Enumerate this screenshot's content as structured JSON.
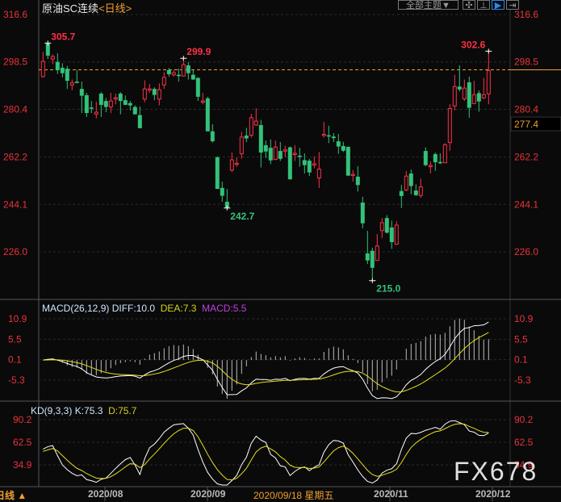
{
  "header": {
    "symbol": "原油SC连续",
    "period": "<日线>",
    "theme_button": "全部主题▼",
    "tool_icons": [
      "crosshair-icon",
      "range-icon",
      "play-icon",
      "exit-icon"
    ]
  },
  "colors": {
    "up": "#ff3048",
    "down": "#33c27a",
    "axis": "#e8323c",
    "accent": "#f0a030",
    "diff": "#ffffff",
    "dea": "#e8e020",
    "macd": "#c040e0"
  },
  "price_axis": {
    "ticks": [
      "316.6",
      "298.5",
      "280.4",
      "262.2",
      "244.1",
      "226.0"
    ],
    "current_marker": "277.4",
    "reference_line": 298.5
  },
  "annotations": {
    "high1": "305.7",
    "high2": "299.9",
    "high3": "302.6",
    "low1": "242.7",
    "low2": "215.0"
  },
  "macd": {
    "title": "MACD(26,12,9)",
    "diff": "DIFF:10.0",
    "dea": "DEA:7.3",
    "macd": "MACD:5.5",
    "ticks": [
      "10.9",
      "5.5",
      "0.1",
      "-5.3"
    ]
  },
  "kd": {
    "title": "KD(9,3,3)",
    "k": "K:75.3",
    "d": "D:75.7",
    "ticks": [
      "90.2",
      "62.5",
      "34.9"
    ]
  },
  "date_axis": {
    "labels": [
      "2020/08",
      "2020/09",
      "2020/11",
      "2020/12"
    ],
    "crosshair_date": "2020/09/18 星期五",
    "period_toggle": "日线 ▲"
  },
  "watermark": "FX678",
  "chart_data": {
    "type": "candlestick",
    "ohlc": [
      [
        292.9,
        302.4,
        292.6,
        298.7
      ],
      [
        305.5,
        305.7,
        299.6,
        300.9
      ],
      [
        299.6,
        301.4,
        297.7,
        300.6
      ],
      [
        298.5,
        301.8,
        293.9,
        295.4
      ],
      [
        296.3,
        298.0,
        292.6,
        294.2
      ],
      [
        295.9,
        297.0,
        288.2,
        291.3
      ],
      [
        289.7,
        291.8,
        287.7,
        290.5
      ],
      [
        291.0,
        295.4,
        290.3,
        290.5
      ],
      [
        288.2,
        291.0,
        279.0,
        285.6
      ],
      [
        285.8,
        286.7,
        277.5,
        279.0
      ],
      [
        281.1,
        283.6,
        279.0,
        280.6
      ],
      [
        278.6,
        283.3,
        276.9,
        279.3
      ],
      [
        286.4,
        287.0,
        277.5,
        282.1
      ],
      [
        283.6,
        284.7,
        279.3,
        281.3
      ],
      [
        281.3,
        286.7,
        279.0,
        283.6
      ],
      [
        284.5,
        286.4,
        282.3,
        284.8
      ],
      [
        286.4,
        287.0,
        278.5,
        283.6
      ],
      [
        283.9,
        285.7,
        282.1,
        282.1
      ],
      [
        282.8,
        283.6,
        280.0,
        281.9
      ],
      [
        281.3,
        281.9,
        278.5,
        278.5
      ],
      [
        278.2,
        281.5,
        273.2,
        273.2
      ],
      [
        284.3,
        291.5,
        283.1,
        288.2
      ],
      [
        287.8,
        290.1,
        286.7,
        288.2
      ],
      [
        288.2,
        288.8,
        283.9,
        285.9
      ],
      [
        284.3,
        290.3,
        281.9,
        287.9
      ],
      [
        289.7,
        294.6,
        288.2,
        292.6
      ],
      [
        295.4,
        296.2,
        292.9,
        293.8
      ],
      [
        293.6,
        295.4,
        292.9,
        294.4
      ],
      [
        293.6,
        296.0,
        291.0,
        293.1
      ],
      [
        293.1,
        299.9,
        292.9,
        297.5
      ],
      [
        297.2,
        298.5,
        291.8,
        294.2
      ],
      [
        293.6,
        295.4,
        291.6,
        291.8
      ],
      [
        292.4,
        292.6,
        283.6,
        285.2
      ],
      [
        283.3,
        286.7,
        282.3,
        283.6
      ],
      [
        284.6,
        285.2,
        272.0,
        272.0
      ],
      [
        272.0,
        274.7,
        267.7,
        268.2
      ],
      [
        262.1,
        262.4,
        250.0,
        250.0
      ],
      [
        250.4,
        252.8,
        245.1,
        247.4
      ],
      [
        245.1,
        250.0,
        242.7,
        242.9
      ],
      [
        257.2,
        263.9,
        256.4,
        261.1
      ],
      [
        259.6,
        262.1,
        258.5,
        259.8
      ],
      [
        263.4,
        271.8,
        261.6,
        269.8
      ],
      [
        270.4,
        273.3,
        267.9,
        269.3
      ],
      [
        270.5,
        278.7,
        269.6,
        277.2
      ],
      [
        274.4,
        280.8,
        274.1,
        275.9
      ],
      [
        274.4,
        276.4,
        258.2,
        263.9
      ],
      [
        266.7,
        268.5,
        261.8,
        264.3
      ],
      [
        265.7,
        268.9,
        259.5,
        260.9
      ],
      [
        261.3,
        268.5,
        261.0,
        266.0
      ],
      [
        264.5,
        267.9,
        260.7,
        261.5
      ],
      [
        264.7,
        266.5,
        262.1,
        264.9
      ],
      [
        265.9,
        266.2,
        253.5,
        253.7
      ],
      [
        263.4,
        266.7,
        260.7,
        263.6
      ],
      [
        262.7,
        265.7,
        258.5,
        262.2
      ],
      [
        261.0,
        263.6,
        255.9,
        259.1
      ],
      [
        260.8,
        261.5,
        254.9,
        256.3
      ],
      [
        259.1,
        262.4,
        257.9,
        259.6
      ],
      [
        254.2,
        264.1,
        250.4,
        257.6
      ],
      [
        270.7,
        275.6,
        269.6,
        270.9
      ],
      [
        270.5,
        274.1,
        267.5,
        270.0
      ],
      [
        270.0,
        271.3,
        267.9,
        269.4
      ],
      [
        268.2,
        271.0,
        263.4,
        266.2
      ],
      [
        266.4,
        268.0,
        264.1,
        264.6
      ],
      [
        266.1,
        266.1,
        254.9,
        255.1
      ],
      [
        255.4,
        257.2,
        252.8,
        255.6
      ],
      [
        254.7,
        258.7,
        249.0,
        251.5
      ],
      [
        244.8,
        247.0,
        235.0,
        236.9
      ],
      [
        225.4,
        234.0,
        221.3,
        222.7
      ],
      [
        226.4,
        227.6,
        215.0,
        219.9
      ],
      [
        222.7,
        232.8,
        222.7,
        228.2
      ],
      [
        234.1,
        238.9,
        231.2,
        237.1
      ],
      [
        238.9,
        240.0,
        233.0,
        233.3
      ],
      [
        235.3,
        237.9,
        227.1,
        229.7
      ],
      [
        228.9,
        237.7,
        228.7,
        236.2
      ],
      [
        249.2,
        251.5,
        242.7,
        247.3
      ],
      [
        249.6,
        256.8,
        249.2,
        254.9
      ],
      [
        255.9,
        257.4,
        247.9,
        251.1
      ],
      [
        249.4,
        251.8,
        247.4,
        247.6
      ],
      [
        247.5,
        254.0,
        246.6,
        250.8
      ],
      [
        264.5,
        265.9,
        258.7,
        259.1
      ],
      [
        258.5,
        260.5,
        255.9,
        259.0
      ],
      [
        263.3,
        263.9,
        256.9,
        260.2
      ],
      [
        260.3,
        263.6,
        259.5,
        259.8
      ],
      [
        260.0,
        267.5,
        260.0,
        266.9
      ],
      [
        267.7,
        282.3,
        264.6,
        280.7
      ],
      [
        281.7,
        293.6,
        280.0,
        289.1
      ],
      [
        289.1,
        297.2,
        287.2,
        288.0
      ],
      [
        284.4,
        291.8,
        283.6,
        288.5
      ],
      [
        290.7,
        292.9,
        277.2,
        281.0
      ],
      [
        282.6,
        291.3,
        282.6,
        286.0
      ],
      [
        286.6,
        287.6,
        279.5,
        283.4
      ],
      [
        284.8,
        292.4,
        284.3,
        286.0
      ],
      [
        286.3,
        302.6,
        282.3,
        295.2
      ]
    ],
    "ylim": [
      215.0,
      316.6
    ],
    "macd_ylim": [
      -5.3,
      10.9
    ],
    "kd_ylim": [
      34.9,
      90.2
    ]
  }
}
